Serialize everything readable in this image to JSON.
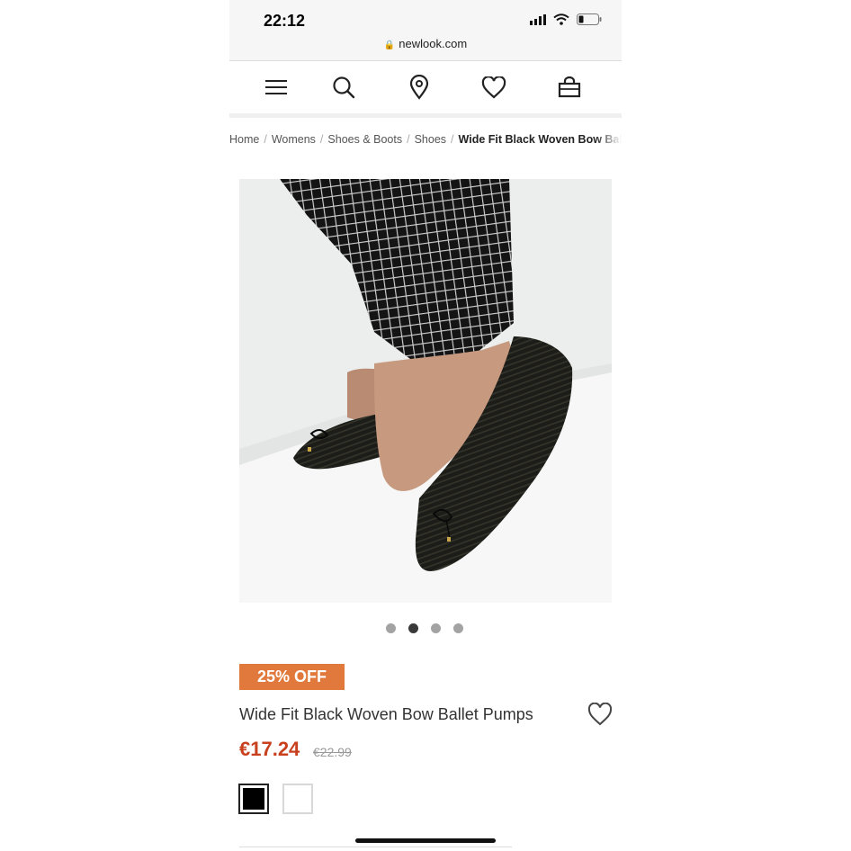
{
  "status_bar": {
    "time": "22:12",
    "url": "newlook.com"
  },
  "nav": {
    "icons": [
      "menu-icon",
      "search-icon",
      "store-locator-icon",
      "wishlist-icon",
      "bag-icon"
    ]
  },
  "breadcrumb": {
    "items": [
      "Home",
      "Womens",
      "Shoes & Boots",
      "Shoes"
    ],
    "current": "Wide Fit Black Woven Bow Ballet Pumps"
  },
  "gallery": {
    "dot_count": 4,
    "active_index": 1
  },
  "product": {
    "badge": "25% OFF",
    "title": "Wide Fit Black Woven Bow Ballet Pumps",
    "price": "€17.24",
    "was_price": "€22.99",
    "swatches": [
      "black",
      "white"
    ]
  },
  "colors": {
    "accent_badge": "#e0793b",
    "price_red": "#c8401e"
  }
}
